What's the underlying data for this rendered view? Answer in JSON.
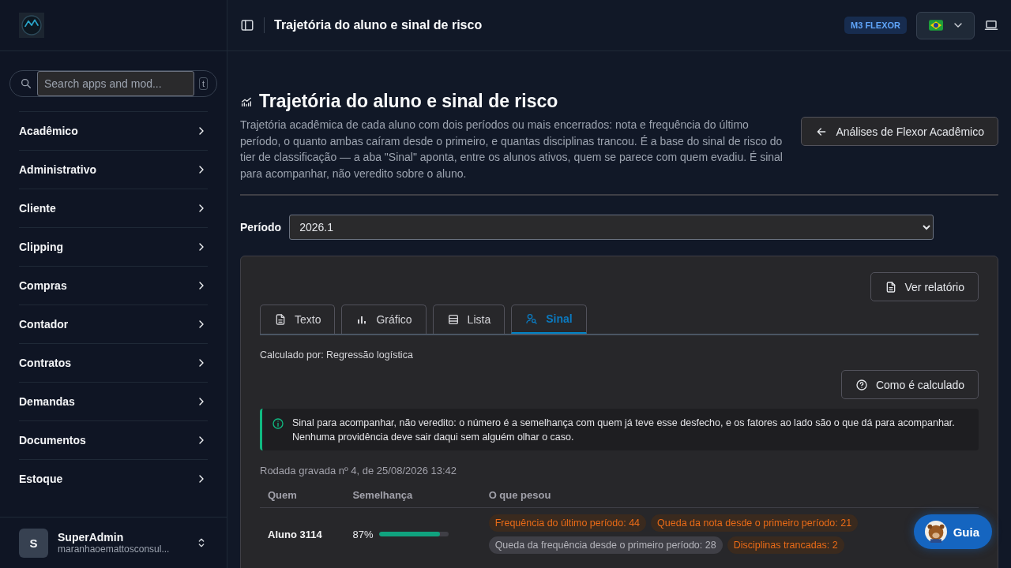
{
  "sidebar": {
    "search": {
      "placeholder": "Search apps and mod...",
      "shortcut": "t"
    },
    "items": [
      {
        "label": "Acadêmico"
      },
      {
        "label": "Administrativo"
      },
      {
        "label": "Cliente"
      },
      {
        "label": "Clipping"
      },
      {
        "label": "Compras"
      },
      {
        "label": "Contador"
      },
      {
        "label": "Contratos"
      },
      {
        "label": "Demandas"
      },
      {
        "label": "Documentos"
      },
      {
        "label": "Estoque"
      }
    ],
    "user": {
      "initial": "S",
      "name": "SuperAdmin",
      "email": "maranhaoemattosconsul..."
    }
  },
  "header": {
    "title": "Trajetória do aluno e sinal de risco",
    "badge": "M3 FLEXOR"
  },
  "page": {
    "title": "Trajetória do aluno e sinal de risco",
    "description": "Trajetória acadêmica de cada aluno com dois períodos ou mais encerrados: nota e frequência do último período, o quanto ambas caíram desde o primeiro, e quantas disciplinas trancou. É a base do sinal de risco do tier de classificação — a aba \"Sinal\" aponta, entre os alunos ativos, quem se parece com quem evadiu. É sinal para acompanhar, não veredito sobre o aluno.",
    "back_button": "Análises de Flexor Acadêmico",
    "period_label": "Período",
    "period_value": "2026.1"
  },
  "panel": {
    "report_button": "Ver relatório",
    "tabs": [
      {
        "label": "Texto",
        "selected": false
      },
      {
        "label": "Gráfico",
        "selected": false
      },
      {
        "label": "Lista",
        "selected": false
      },
      {
        "label": "Sinal",
        "selected": true
      }
    ],
    "calculated_by": "Calculado por: Regressão logística",
    "how_button": "Como é calculado",
    "notice": "Sinal para acompanhar, não veredito: o número é a semelhança com quem já teve esse desfecho, e os fatores ao lado são o que dá para acompanhar. Nenhuma providência deve sair daqui sem alguém olhar o caso.",
    "run_info": "Rodada gravada nº 4, de 25/08/2026 13:42",
    "table": {
      "columns": [
        "Quem",
        "Semelhança",
        "O que pesou"
      ],
      "rows": [
        {
          "who": "Aluno 3114",
          "similarity": "87%",
          "level": 0.87,
          "factors": [
            {
              "text": "Frequência do último período: 44",
              "kind": "warn"
            },
            {
              "text": "Queda da nota desde o primeiro período: 21",
              "kind": "warn"
            },
            {
              "text": "Queda da frequência desde o primeiro período: 28",
              "kind": "neutral"
            },
            {
              "text": "Disciplinas trancadas: 2",
              "kind": "warn"
            }
          ]
        }
      ]
    }
  },
  "guide_button": "Guia"
}
